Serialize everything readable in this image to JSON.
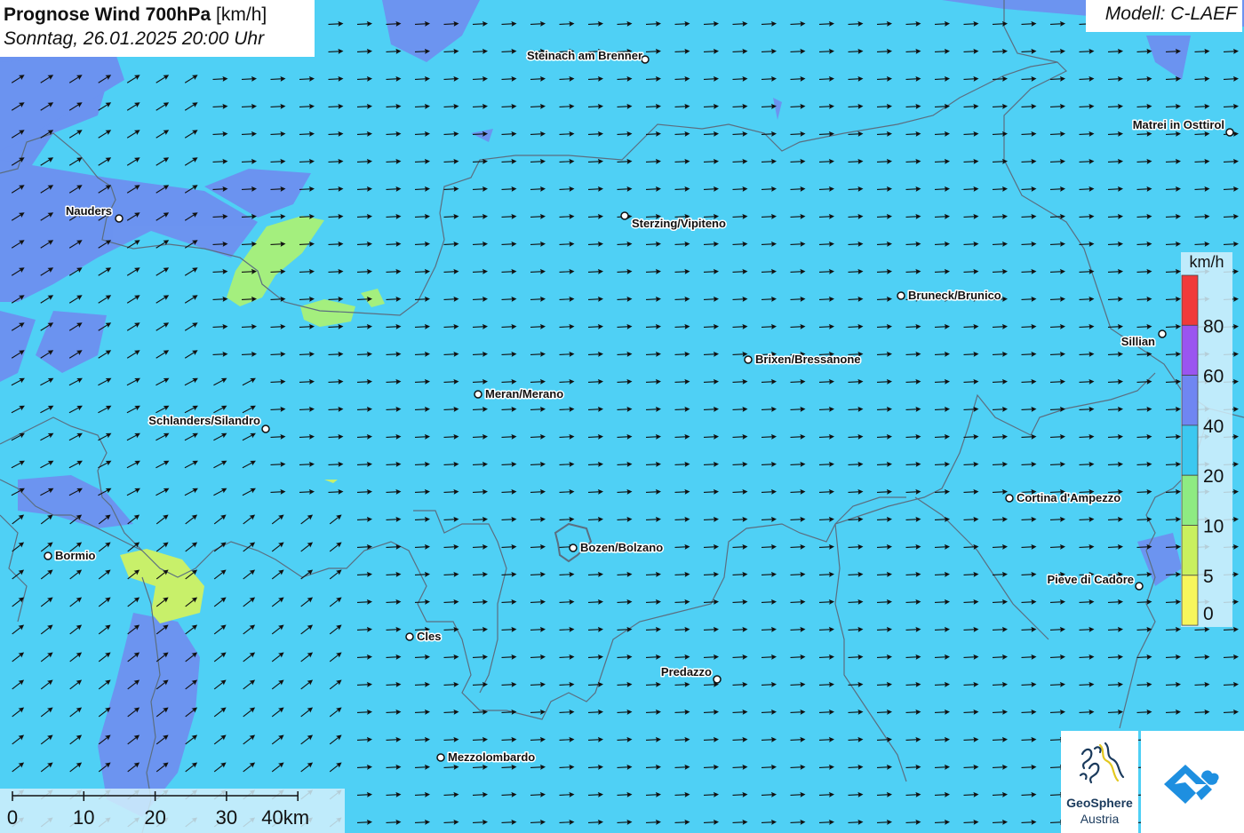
{
  "title": {
    "main": "Prognose Wind 700hPa",
    "unit": "[km/h]",
    "datetime": "Sonntag, 26.01.2025 20:00 Uhr"
  },
  "model": "Modell: C-LAEF",
  "legend": {
    "unit": "km/h",
    "items": [
      {
        "label": "",
        "color": "#f03a3a"
      },
      {
        "label": "80",
        "color": "#9a55f0"
      },
      {
        "label": "60",
        "color": "#6f86f2"
      },
      {
        "label": "40",
        "color": "#3cc8f0"
      },
      {
        "label": "20",
        "color": "#8eeb82"
      },
      {
        "label": "10",
        "color": "#c9f05e"
      },
      {
        "label": "5",
        "color": "#f7f65c"
      }
    ],
    "bottom_label": "0"
  },
  "scale_bar": {
    "ticks": [
      "0",
      "10",
      "20",
      "30",
      "40km"
    ]
  },
  "cities": [
    {
      "name": "Steinach am Brenner",
      "anchor": "end"
    },
    {
      "name": "Matrei in Osttirol",
      "anchor": "end"
    },
    {
      "name": "Nauders",
      "anchor": "end"
    },
    {
      "name": "Sterzing/Vipiteno",
      "anchor": "start"
    },
    {
      "name": "Bruneck/Brunico",
      "anchor": "start"
    },
    {
      "name": "Sillian",
      "anchor": "end"
    },
    {
      "name": "Brixen/Bressanone",
      "anchor": "start"
    },
    {
      "name": "Meran/Merano",
      "anchor": "start"
    },
    {
      "name": "Schlanders/Silandro",
      "anchor": "end"
    },
    {
      "name": "Cortina d'Ampezzo",
      "anchor": "start"
    },
    {
      "name": "Bozen/Bolzano",
      "anchor": "start"
    },
    {
      "name": "Bormio",
      "anchor": "start"
    },
    {
      "name": "Pieve di Cadore",
      "anchor": "end"
    },
    {
      "name": "Cles",
      "anchor": "start"
    },
    {
      "name": "Predazzo",
      "anchor": "end"
    },
    {
      "name": "Mezzolombardo",
      "anchor": "start"
    }
  ],
  "logos": {
    "geosphere_line1": "GeoSphere",
    "geosphere_line2": "Austria"
  },
  "colors": {
    "wind_20_40": "#4fd0f5",
    "wind_40_60": "#6f8df0",
    "wind_10_20": "#a4ef7e",
    "wind_5_10": "#d2f05a",
    "border": "#5b6e80"
  }
}
